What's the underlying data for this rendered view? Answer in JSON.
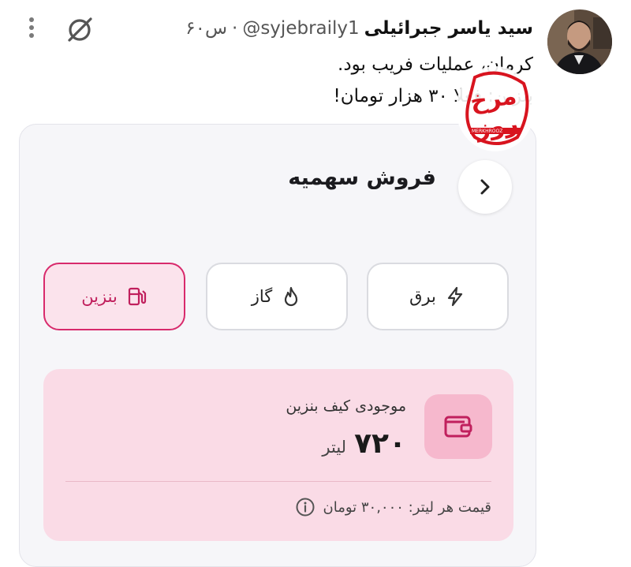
{
  "tweet": {
    "author_name": "سید یاسر جبرائیلی",
    "author_handle": "@syjebraily1",
    "separator": "·",
    "timestamp": "۶۰س",
    "text_lines": [
      "کرمان، عملیات فریب بود.",
      "بنزین: فعلا ۳۰ هزار تومان!"
    ],
    "icons": {
      "more": "more-vertical-icon",
      "grok": "grok-icon"
    }
  },
  "app": {
    "title": "فروش سهمیه",
    "back_icon": "chevron-right-icon",
    "watermark": {
      "text": "مرخ روز",
      "url": "MERKHROOZ"
    },
    "tabs": [
      {
        "label": "برق",
        "icon": "lightning-icon",
        "active": false
      },
      {
        "label": "گاز",
        "icon": "flame-icon",
        "active": false
      },
      {
        "label": "بنزین",
        "icon": "fuel-pump-icon",
        "active": true
      }
    ],
    "wallet": {
      "title": "موجودی کیف بنزین",
      "amount": "۷۲۰",
      "unit": "لیتر",
      "icon": "wallet-icon",
      "price_text": "قیمت هر لیتر: ۳۰,۰۰۰ تومان",
      "price_icon": "info-icon"
    }
  },
  "colors": {
    "accent": "#d82a6c",
    "panel_bg": "#fadbe6",
    "card_bg": "#f6f6f9",
    "watermark_red": "#d8141f"
  }
}
